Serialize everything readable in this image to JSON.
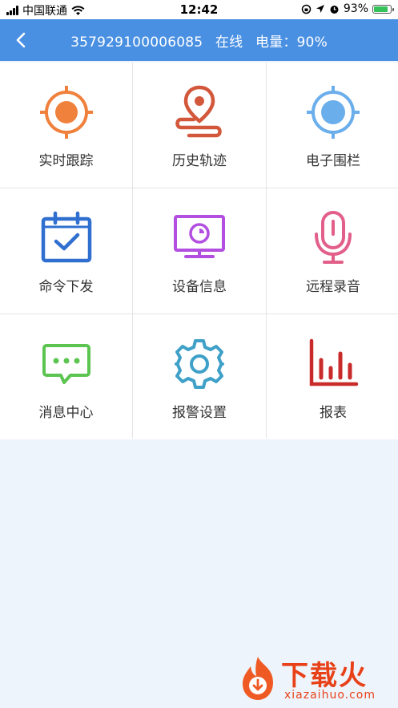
{
  "status_bar": {
    "carrier": "中国联通",
    "time": "12:42",
    "battery": "93%"
  },
  "nav": {
    "device_id": "357929100006085",
    "status": "在线",
    "battery_label": "电量：90%"
  },
  "menu": [
    {
      "label": "实时跟踪",
      "icon": "target-icon",
      "color": "#f0813c"
    },
    {
      "label": "历史轨迹",
      "icon": "route-pin-icon",
      "color": "#d3573a"
    },
    {
      "label": "电子围栏",
      "icon": "fence-target-icon",
      "color": "#6aaeeb"
    },
    {
      "label": "命令下发",
      "icon": "calendar-check-icon",
      "color": "#2f6fd0"
    },
    {
      "label": "设备信息",
      "icon": "monitor-icon",
      "color": "#b24fe0"
    },
    {
      "label": "远程录音",
      "icon": "microphone-icon",
      "color": "#e25f8a"
    },
    {
      "label": "消息中心",
      "icon": "chat-bubble-icon",
      "color": "#5cc450"
    },
    {
      "label": "报警设置",
      "icon": "gear-icon",
      "color": "#3fa0c8"
    },
    {
      "label": "报表",
      "icon": "bar-chart-icon",
      "color": "#c92a2a"
    }
  ],
  "watermark": {
    "title": "下载火",
    "subtitle": "xiazaihuo.com"
  }
}
